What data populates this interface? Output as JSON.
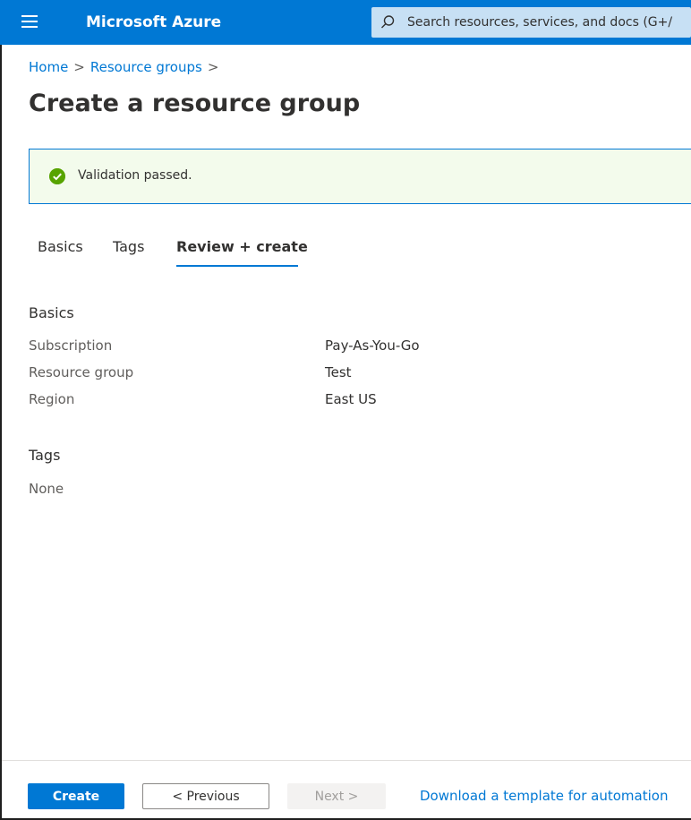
{
  "topbar": {
    "brand": "Microsoft Azure",
    "search_placeholder": "Search resources, services, and docs (G+/"
  },
  "breadcrumb": {
    "items": [
      "Home",
      "Resource groups"
    ],
    "separator": ">"
  },
  "page": {
    "title": "Create a resource group"
  },
  "validation": {
    "message": "Validation passed.",
    "status_color": "#57a300"
  },
  "tabs": [
    {
      "label": "Basics",
      "active": false
    },
    {
      "label": "Tags",
      "active": false
    },
    {
      "label": "Review + create",
      "active": true
    }
  ],
  "basics": {
    "heading": "Basics",
    "rows": [
      {
        "label": "Subscription",
        "value": "Pay-As-You-Go"
      },
      {
        "label": "Resource group",
        "value": "Test"
      },
      {
        "label": "Region",
        "value": "East US"
      }
    ]
  },
  "tags": {
    "heading": "Tags",
    "value": "None"
  },
  "footer": {
    "create_label": "Create",
    "previous_label": "< Previous",
    "next_label": "Next >",
    "download_link": "Download a template for automation"
  },
  "colors": {
    "accent": "#0078d4",
    "banner_bg": "#f3fbec"
  }
}
